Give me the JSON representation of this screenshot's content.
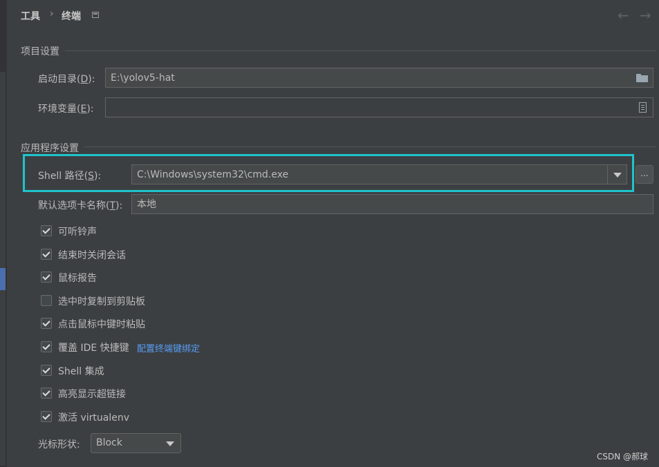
{
  "breadcrumb": {
    "parent": "工具",
    "separator": "›",
    "current": "终端"
  },
  "nav": {
    "back": "←",
    "forward": "→"
  },
  "project_settings": {
    "title": "项目设置",
    "start_dir_label": "启动目录(",
    "start_dir_mnemonic": "D",
    "start_dir_label_end": "):",
    "start_dir_value": "E:\\yolov5-hat",
    "env_label": "环境变量(",
    "env_mnemonic": "E",
    "env_label_end": "):",
    "env_value": ""
  },
  "app_settings": {
    "title": "应用程序设置",
    "shell_label": "Shell 路径(",
    "shell_mnemonic": "S",
    "shell_label_end": "):",
    "shell_value": "C:\\Windows\\system32\\cmd.exe",
    "browse_label": "...",
    "tab_name_label": "默认选项卡名称(",
    "tab_name_mnemonic": "T",
    "tab_name_label_end": "):",
    "tab_name_value": "本地"
  },
  "checkboxes": [
    {
      "label": "可听铃声",
      "checked": true
    },
    {
      "label": "结束时关闭会话",
      "checked": true
    },
    {
      "label": "鼠标报告",
      "checked": true
    },
    {
      "label": "选中时复制到剪贴板",
      "checked": false
    },
    {
      "label": "点击鼠标中键时粘贴",
      "checked": true
    },
    {
      "label": "覆盖 IDE 快捷键",
      "checked": true,
      "link": "配置终端键绑定"
    },
    {
      "label": "Shell 集成",
      "checked": true
    },
    {
      "label": "高亮显示超链接",
      "checked": true
    },
    {
      "label": "激活 virtualenv",
      "checked": true
    }
  ],
  "cursor": {
    "label": "光标形状:",
    "value": "Block"
  },
  "watermark": "CSDN @郝球",
  "colors": {
    "highlight": "#1fc4cc",
    "link": "#589df6",
    "background": "#3c3f41"
  }
}
